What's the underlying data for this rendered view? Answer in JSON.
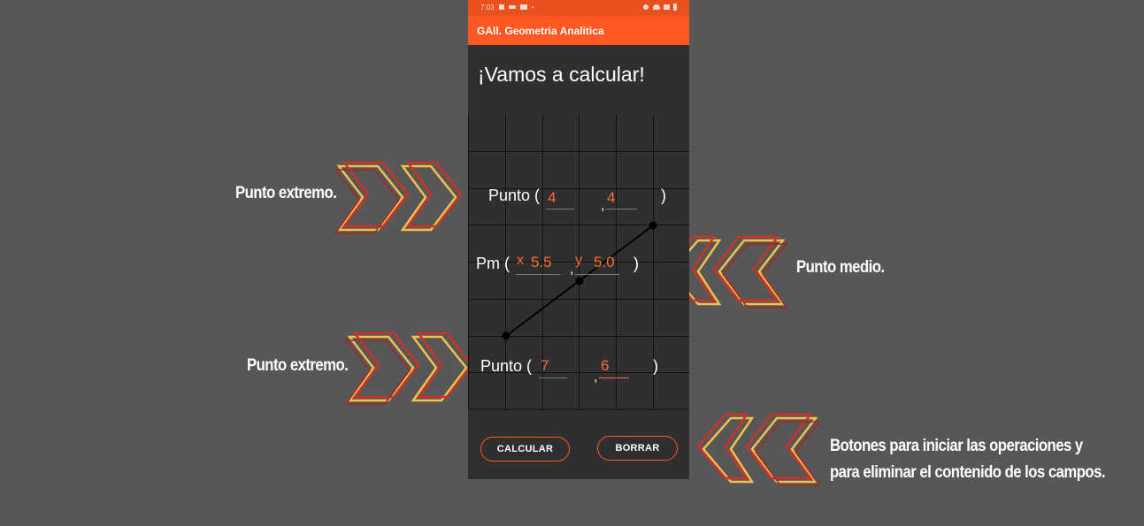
{
  "annotations": {
    "endpoint_top": "Punto extremo.",
    "endpoint_bottom": "Punto extremo.",
    "midpoint": "Punto medio.",
    "buttons_line1": "Botones para iniciar las operaciones y",
    "buttons_line2": "para eliminar el contenido de los campos."
  },
  "status_bar": {
    "time": "7:03"
  },
  "app_bar": {
    "title": "GAll. Geometria Analitica"
  },
  "main": {
    "heading": "¡Vamos a calcular!",
    "point1": {
      "prefix": "Punto (",
      "x": "4",
      "y": "4",
      "suffix": ")",
      "separator": ","
    },
    "midpoint": {
      "prefix": "Pm (",
      "x_label": "x",
      "x": "5.5",
      "y_label": "y",
      "y": "5.0",
      "suffix": ")",
      "separator": ","
    },
    "point2": {
      "prefix": "Punto (",
      "x": "7",
      "y": "6",
      "suffix": ")",
      "separator": ","
    }
  },
  "buttons": {
    "calculate": "CALCULAR",
    "clear": "BORRAR"
  },
  "colors": {
    "accent": "#ff5722",
    "status_bar": "#e8501f",
    "background": "#575757",
    "phone_background": "#2f2f2f",
    "input_text": "#ff6a33",
    "arrow_red": "#c9332a",
    "arrow_yellow": "#f2c14e"
  },
  "icons": [
    "gallery-icon",
    "voicemail-icon",
    "youtube-icon",
    "dot-icon",
    "alarm-icon",
    "wifi-icon",
    "signal-icon",
    "battery-icon",
    "left-arrow-annotation-icon",
    "right-arrow-annotation-icon"
  ]
}
